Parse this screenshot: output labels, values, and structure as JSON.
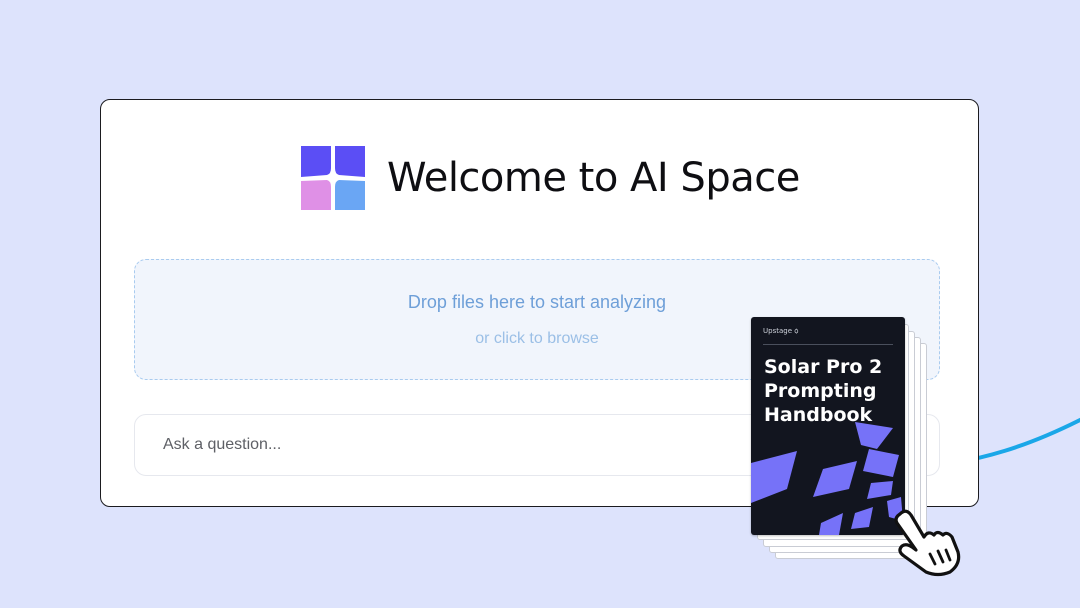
{
  "app": {
    "title": "Welcome to AI Space",
    "logo_icon": "ai-space-logo-icon",
    "logo_colors": [
      "#5b4ef5",
      "#5b4ef5",
      "#df90e6",
      "#6aa6f4"
    ]
  },
  "dropzone": {
    "primary_text": "Drop files here to start analyzing",
    "secondary_text": "or click to browse"
  },
  "ask": {
    "placeholder": "Ask a question..."
  },
  "document": {
    "brand": "Upstage ꟁ",
    "title": "Solar Pro 2\nPrompting\nHandbook"
  },
  "colors": {
    "background": "#dde3fc",
    "accent": "#5b4ef5",
    "connector": "#1aa7e8",
    "shapes": "#7672f8"
  },
  "cursor": {
    "icon": "hand-pointer-icon"
  }
}
